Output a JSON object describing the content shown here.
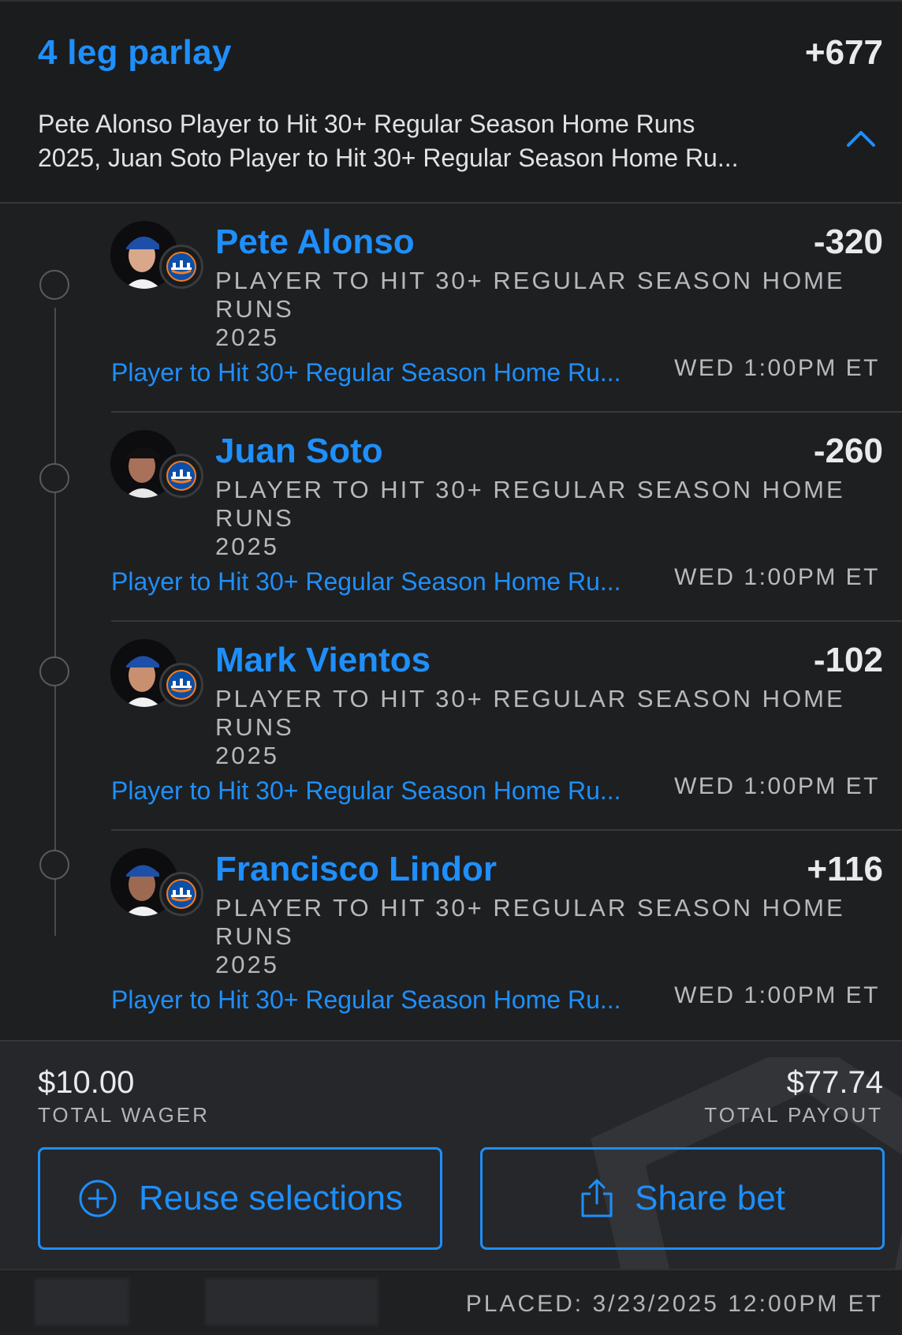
{
  "header": {
    "title": "4 leg parlay",
    "odds": "+677",
    "summary_line1": "Pete Alonso Player to Hit 30+ Regular Season Home Runs",
    "summary_line2": "2025, Juan Soto Player to Hit 30+ Regular Season Home Ru..."
  },
  "legs": [
    {
      "player": "Pete Alonso",
      "odds": "-320",
      "market_line1": "PLAYER TO HIT 30+ REGULAR SEASON HOME RUNS",
      "market_line2": "2025",
      "market_link": "Player to Hit 30+ Regular Season Home Ru...",
      "time": "WED 1:00PM ET"
    },
    {
      "player": "Juan Soto",
      "odds": "-260",
      "market_line1": "PLAYER TO HIT 30+ REGULAR SEASON HOME RUNS",
      "market_line2": "2025",
      "market_link": "Player to Hit 30+ Regular Season Home Ru...",
      "time": "WED 1:00PM ET"
    },
    {
      "player": "Mark Vientos",
      "odds": "-102",
      "market_line1": "PLAYER TO HIT 30+ REGULAR SEASON HOME RUNS",
      "market_line2": "2025",
      "market_link": "Player to Hit 30+ Regular Season Home Ru...",
      "time": "WED 1:00PM ET"
    },
    {
      "player": "Francisco Lindor",
      "odds": "+116",
      "market_line1": "PLAYER TO HIT 30+ REGULAR SEASON HOME RUNS",
      "market_line2": "2025",
      "market_link": "Player to Hit 30+ Regular Season Home Ru...",
      "time": "WED 1:00PM ET"
    }
  ],
  "footer": {
    "wager_amount": "$10.00",
    "wager_label": "TOTAL WAGER",
    "payout_amount": "$77.74",
    "payout_label": "TOTAL PAYOUT",
    "reuse_label": "Reuse selections",
    "share_label": "Share bet",
    "placed": "PLACED: 3/23/2025 12:00PM ET"
  },
  "icons": {
    "expand": "chevron-up-icon",
    "reuse": "plus-circle-icon",
    "share": "share-icon",
    "team": "mets-logo-icon"
  },
  "colors": {
    "accent": "#1e8ffb",
    "background": "#1b1c1e",
    "footer": "#26272a"
  }
}
